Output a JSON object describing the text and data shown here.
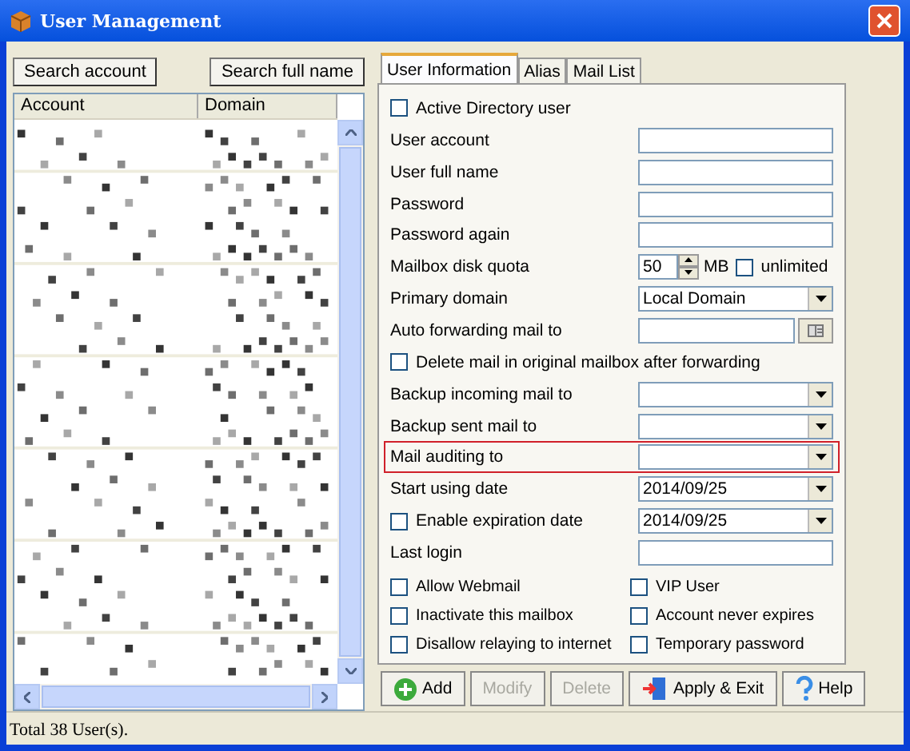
{
  "window": {
    "title": "User Management"
  },
  "search_buttons": [
    "Search account",
    "Search full name"
  ],
  "list": {
    "columns": [
      "Account",
      "Domain"
    ]
  },
  "tabs": [
    {
      "label": "User Information",
      "selected": true
    },
    {
      "label": "Alias",
      "selected": false
    },
    {
      "label": "Mail List",
      "selected": false
    }
  ],
  "fields": [
    {
      "kind": "checkbox",
      "label": "Active Directory user",
      "checked": false
    },
    {
      "kind": "text",
      "label": "User account"
    },
    {
      "kind": "text",
      "label": "User full name"
    },
    {
      "kind": "text",
      "label": "Password"
    },
    {
      "kind": "text",
      "label": "Password again"
    },
    {
      "kind": "spin",
      "label": "Mailbox disk quota",
      "value": "50",
      "unit": "MB",
      "option": {
        "label": "unlimited",
        "checked": false
      }
    },
    {
      "kind": "select",
      "label": "Primary domain",
      "value": "Local Domain"
    },
    {
      "kind": "browse",
      "label": "Auto forwarding mail to"
    },
    {
      "kind": "checkbox",
      "label": "Delete mail in original mailbox after forwarding",
      "checked": false
    },
    {
      "kind": "select",
      "label": "Backup incoming  mail to"
    },
    {
      "kind": "select",
      "label": "Backup sent mail to"
    },
    {
      "kind": "select",
      "label": "Mail auditing to",
      "highlighted": true
    },
    {
      "kind": "select",
      "label": "Start using date",
      "value": "2014/09/25"
    },
    {
      "kind": "checkselect",
      "label": "Enable expiration date",
      "checked": false,
      "value": "2014/09/25"
    },
    {
      "kind": "text",
      "label": "Last login"
    }
  ],
  "options": [
    {
      "label": "Allow Webmail",
      "checked": false
    },
    {
      "label": "VIP User",
      "checked": false
    },
    {
      "label": "Inactivate this mailbox",
      "checked": false
    },
    {
      "label": "Account never expires",
      "checked": false
    },
    {
      "label": "Disallow relaying to internet",
      "checked": false
    },
    {
      "label": "Temporary password",
      "checked": false
    }
  ],
  "actions": [
    {
      "kind": "add",
      "label": "Add",
      "disabled": false
    },
    {
      "kind": "plain",
      "label": "Modify",
      "disabled": true
    },
    {
      "kind": "plain",
      "label": "Delete",
      "disabled": true
    },
    {
      "kind": "exit",
      "label": "Apply & Exit",
      "disabled": false
    },
    {
      "kind": "help",
      "label": "Help",
      "disabled": false
    }
  ],
  "status_bar": "Total 38 User(s)."
}
